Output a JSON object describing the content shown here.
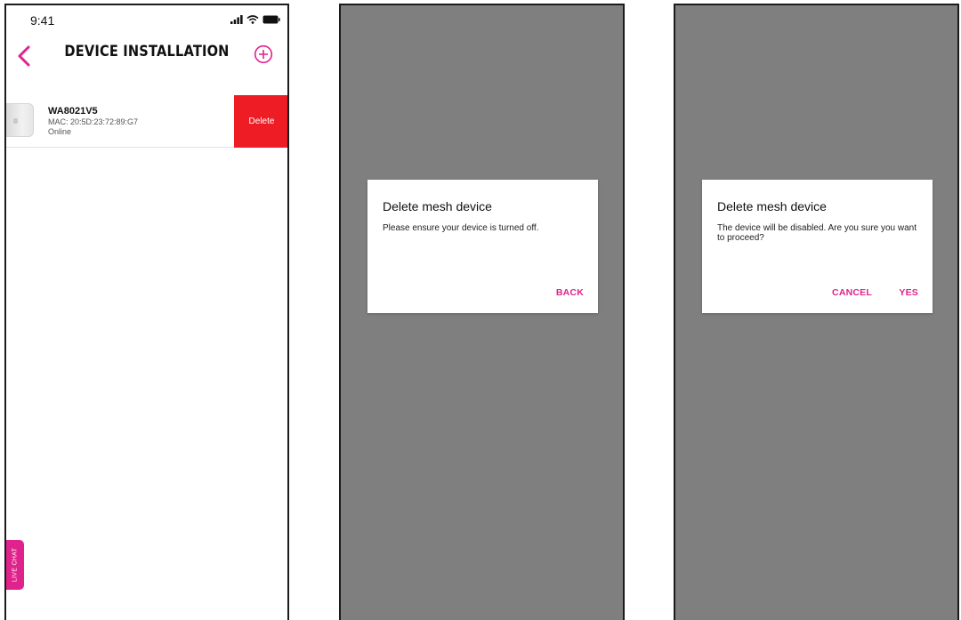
{
  "colors": {
    "accent": "#e0228c",
    "delete": "#ee1c25",
    "overlay": "#7f7f7f"
  },
  "screen1": {
    "status_time": "9:41",
    "title": "DEVICE INSTALLATION",
    "device": {
      "name": "WA8021V5",
      "mac": "MAC: 20:5D:23:72:89:G7",
      "status": "Online"
    },
    "delete_label": "Delete",
    "live_chat_label": "LIVE CHAT",
    "icons": {
      "back": "chevron-left-icon",
      "add": "plus-circle-icon"
    }
  },
  "screen2": {
    "dialog": {
      "title": "Delete mesh device",
      "message": "Please ensure your device is turned off.",
      "back_label": "BACK"
    }
  },
  "screen3": {
    "dialog": {
      "title": "Delete mesh device",
      "message": "The device will be disabled. Are you sure you want to proceed?",
      "cancel_label": "CANCEL",
      "yes_label": "YES"
    }
  }
}
